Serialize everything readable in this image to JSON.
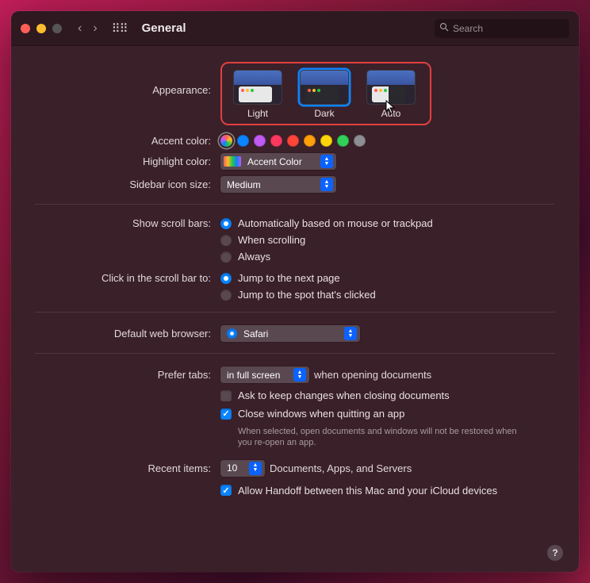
{
  "window": {
    "title": "General",
    "search_placeholder": "Search"
  },
  "appearance": {
    "label": "Appearance:",
    "options": [
      "Light",
      "Dark",
      "Auto"
    ],
    "selected": "Dark"
  },
  "accent": {
    "label": "Accent color:",
    "colors": [
      "multicolor",
      "#0a84ff",
      "#bf5af2",
      "#ff3860",
      "#ff453a",
      "#ff9f0a",
      "#ffd60a",
      "#30d158",
      "#8e8e93"
    ],
    "selected_index": 0
  },
  "highlight": {
    "label": "Highlight color:",
    "value": "Accent Color"
  },
  "sidebar_icon": {
    "label": "Sidebar icon size:",
    "value": "Medium"
  },
  "scrollbars": {
    "label": "Show scroll bars:",
    "options": [
      "Automatically based on mouse or trackpad",
      "When scrolling",
      "Always"
    ],
    "selected_index": 0
  },
  "scroll_click": {
    "label": "Click in the scroll bar to:",
    "options": [
      "Jump to the next page",
      "Jump to the spot that's clicked"
    ],
    "selected_index": 0
  },
  "browser": {
    "label": "Default web browser:",
    "value": "Safari"
  },
  "tabs": {
    "label": "Prefer tabs:",
    "value": "in full screen",
    "suffix": "when opening documents"
  },
  "ask_keep_changes": {
    "label": "Ask to keep changes when closing documents",
    "checked": false
  },
  "close_windows": {
    "label": "Close windows when quitting an app",
    "hint": "When selected, open documents and windows will not be restored when you re-open an app.",
    "checked": true
  },
  "recent": {
    "label": "Recent items:",
    "value": "10",
    "suffix": "Documents, Apps, and Servers"
  },
  "handoff": {
    "label": "Allow Handoff between this Mac and your iCloud devices",
    "checked": true
  }
}
